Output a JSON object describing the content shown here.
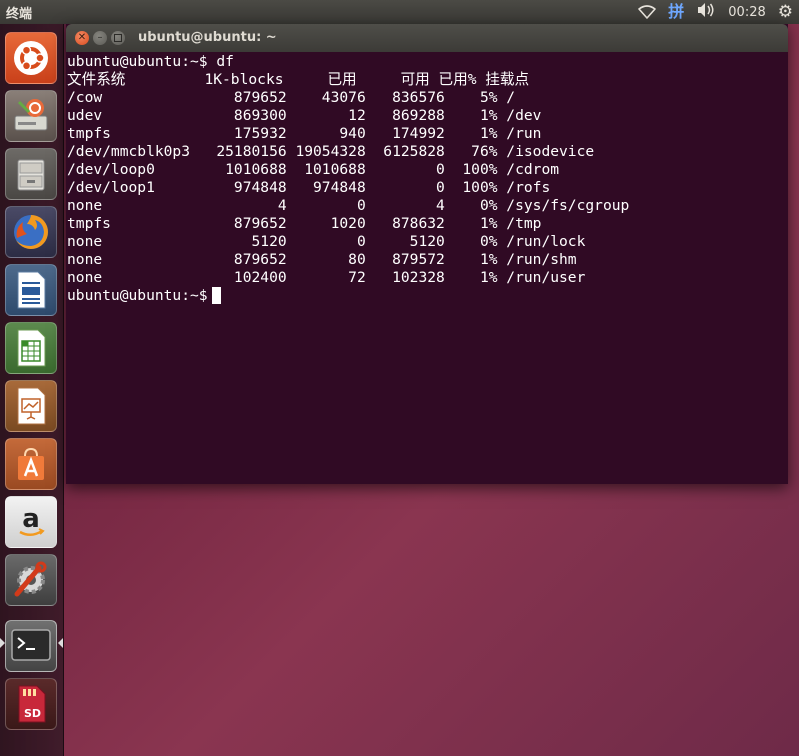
{
  "topbar": {
    "app_title": "终端",
    "input_method": "拼",
    "clock": "00:28",
    "icons": [
      "wifi-icon",
      "input-method-icon",
      "volume-icon",
      "settings-gear-icon"
    ]
  },
  "launcher": {
    "items": [
      {
        "name": "dash-home",
        "icon": "ubuntu-logo-icon"
      },
      {
        "name": "ubuntu-installer",
        "icon": "install-icon"
      },
      {
        "name": "files",
        "icon": "file-cabinet-icon"
      },
      {
        "name": "firefox",
        "icon": "firefox-icon"
      },
      {
        "name": "libreoffice-writer",
        "icon": "writer-icon"
      },
      {
        "name": "libreoffice-calc",
        "icon": "calc-icon"
      },
      {
        "name": "libreoffice-impress",
        "icon": "impress-icon"
      },
      {
        "name": "software-center",
        "icon": "shopping-bag-icon"
      },
      {
        "name": "amazon",
        "icon": "amazon-icon"
      },
      {
        "name": "system-settings",
        "icon": "settings-icon"
      },
      {
        "name": "terminal",
        "icon": "terminal-icon"
      },
      {
        "name": "sd-card",
        "icon": "sd-card-icon",
        "label": "SD"
      }
    ]
  },
  "terminal": {
    "title": "ubuntu@ubuntu: ~",
    "prompt": "ubuntu@ubuntu:~$",
    "command": "df",
    "header": {
      "filesystem": "文件系统",
      "blocks": "1K-blocks",
      "used": "已用",
      "available": "可用",
      "use_pct": "已用%",
      "mounted_on": "挂载点"
    },
    "rows": [
      {
        "fs": "/cow",
        "blocks": "879652",
        "used": "43076",
        "avail": "836576",
        "pct": "5%",
        "mount": "/"
      },
      {
        "fs": "udev",
        "blocks": "869300",
        "used": "12",
        "avail": "869288",
        "pct": "1%",
        "mount": "/dev"
      },
      {
        "fs": "tmpfs",
        "blocks": "175932",
        "used": "940",
        "avail": "174992",
        "pct": "1%",
        "mount": "/run"
      },
      {
        "fs": "/dev/mmcblk0p3",
        "blocks": "25180156",
        "used": "19054328",
        "avail": "6125828",
        "pct": "76%",
        "mount": "/isodevice"
      },
      {
        "fs": "/dev/loop0",
        "blocks": "1010688",
        "used": "1010688",
        "avail": "0",
        "pct": "100%",
        "mount": "/cdrom"
      },
      {
        "fs": "/dev/loop1",
        "blocks": "974848",
        "used": "974848",
        "avail": "0",
        "pct": "100%",
        "mount": "/rofs"
      },
      {
        "fs": "none",
        "blocks": "4",
        "used": "0",
        "avail": "4",
        "pct": "0%",
        "mount": "/sys/fs/cgroup"
      },
      {
        "fs": "tmpfs",
        "blocks": "879652",
        "used": "1020",
        "avail": "878632",
        "pct": "1%",
        "mount": "/tmp"
      },
      {
        "fs": "none",
        "blocks": "5120",
        "used": "0",
        "avail": "5120",
        "pct": "0%",
        "mount": "/run/lock"
      },
      {
        "fs": "none",
        "blocks": "879652",
        "used": "80",
        "avail": "879572",
        "pct": "1%",
        "mount": "/run/shm"
      },
      {
        "fs": "none",
        "blocks": "102400",
        "used": "72",
        "avail": "102328",
        "pct": "1%",
        "mount": "/run/user"
      }
    ],
    "colors": {
      "background": "#300a24",
      "foreground": "#ffffff"
    }
  }
}
